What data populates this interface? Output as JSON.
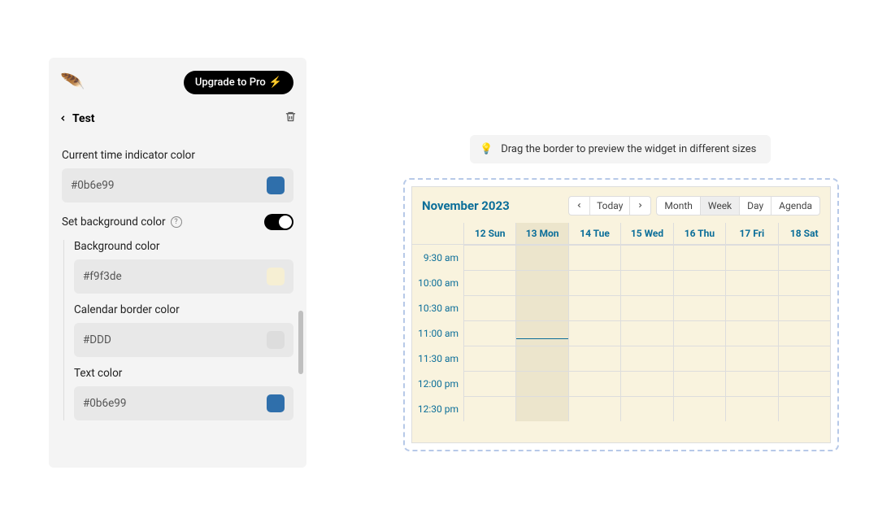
{
  "sidebar": {
    "breadcrumb_title": "Test",
    "upgrade_label": "Upgrade to Pro",
    "sections": {
      "current_time_indicator": {
        "label": "Current time indicator color",
        "value": "#0b6e99",
        "swatch": "#2f6fab"
      },
      "set_bg": {
        "label": "Set background color",
        "on": true
      },
      "bg_color": {
        "label": "Background color",
        "value": "#f9f3de",
        "swatch": "#f6efd3"
      },
      "border_color": {
        "label": "Calendar border color",
        "value": "#DDD",
        "swatch": "#dddddd"
      },
      "text_color": {
        "label": "Text color",
        "value": "#0b6e99",
        "swatch": "#2f6fab"
      }
    }
  },
  "hint": {
    "text": "Drag the border to preview the widget in different sizes"
  },
  "calendar": {
    "title": "November 2023",
    "nav": {
      "today": "Today"
    },
    "views": [
      {
        "label": "Month",
        "active": false
      },
      {
        "label": "Week",
        "active": true
      },
      {
        "label": "Day",
        "active": false
      },
      {
        "label": "Agenda",
        "active": false
      }
    ],
    "days": [
      {
        "label": "12 Sun",
        "today": false
      },
      {
        "label": "13 Mon",
        "today": true
      },
      {
        "label": "14 Tue",
        "today": false
      },
      {
        "label": "15 Wed",
        "today": false
      },
      {
        "label": "16 Thu",
        "today": false
      },
      {
        "label": "17 Fri",
        "today": false
      },
      {
        "label": "18 Sat",
        "today": false
      }
    ],
    "times": [
      "9:30 am",
      "10:00 am",
      "10:30 am",
      "11:00 am",
      "11:30 am",
      "12:00 pm",
      "12:30 pm"
    ],
    "now_row_index": 3
  }
}
